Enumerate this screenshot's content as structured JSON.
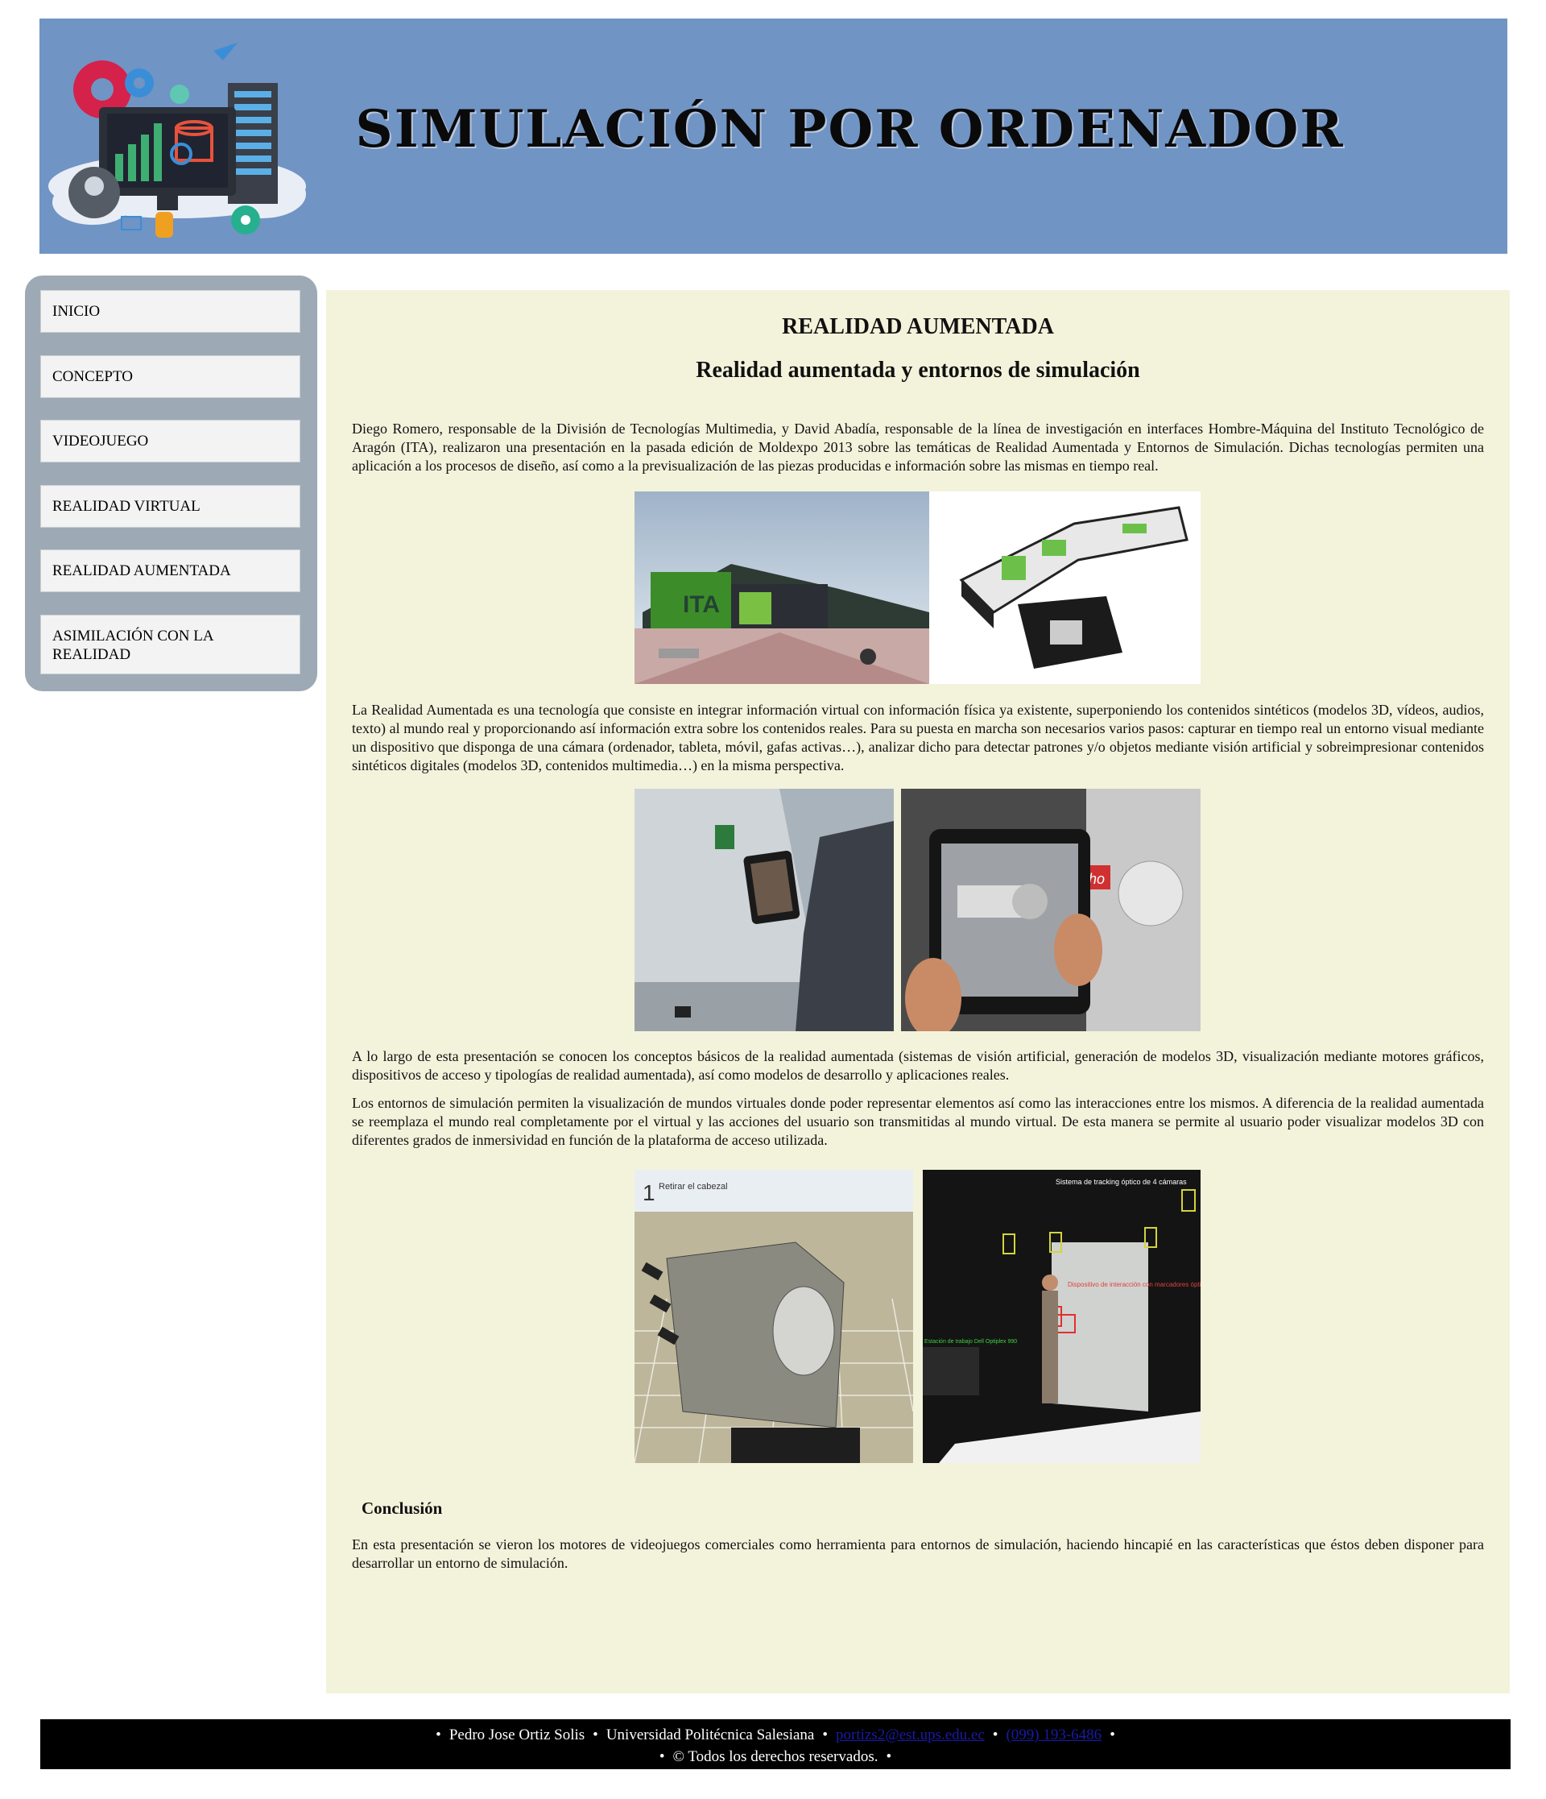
{
  "header": {
    "title": "SIMULACIÓN POR ORDENADOR",
    "logo_icon": "computer-server-illustration"
  },
  "sidebar": {
    "items": [
      {
        "label": "INICIO"
      },
      {
        "label": "CONCEPTO"
      },
      {
        "label": "VIDEOJUEGO"
      },
      {
        "label": "REALIDAD VIRTUAL"
      },
      {
        "label": "REALIDAD AUMENTADA"
      },
      {
        "label": "ASIMILACIÓN CON LA REALIDAD"
      }
    ]
  },
  "main": {
    "title": "REALIDAD AUMENTADA",
    "subtitle": "Realidad aumentada y entornos de simulación",
    "paragraphs": [
      "Diego Romero, responsable de la División de Tecnologías Multimedia, y David Abadía, responsable de la línea de investigación en interfaces Hombre-Máquina del Instituto Tecnológico de Aragón (ITA), realizaron una presentación en la pasada edición de Moldexpo 2013 sobre las temáticas de Realidad Aumentada y Entornos de Simulación. Dichas tecnologías permiten una aplicación a los procesos de diseño, así como a la previsualización de las piezas producidas e información sobre las mismas en tiempo real.",
      "La Realidad Aumentada es una tecnología que consiste en integrar información virtual con información física ya existente, superponiendo los contenidos sintéticos (modelos 3D, vídeos, audios, texto) al mundo real y proporcionando así información extra sobre los contenidos reales. Para su puesta en marcha son necesarios varios pasos: capturar en tiempo real un entorno visual mediante un dispositivo que disponga de una cámara (ordenador, tableta, móvil, gafas activas…), analizar dicho para detectar patrones y/o objetos mediante visión artificial y sobreimpresionar contenidos sintéticos digitales (modelos 3D, contenidos multimedia…) en la misma perspectiva.",
      "A lo largo de esta presentación se conocen los conceptos básicos de la realidad aumentada (sistemas de visión artificial, generación de modelos 3D, visualización mediante motores gráficos, dispositivos de acceso y tipologías de realidad aumentada), así como modelos de desarrollo y aplicaciones reales.",
      "Los entornos de simulación permiten la visualización de mundos virtuales donde poder representar elementos así como las interacciones entre los mismos. A diferencia de la realidad aumentada se reemplaza el mundo real completamente por el virtual y las acciones del usuario son transmitidas al mundo virtual. De esta manera se permite al usuario poder visualizar modelos 3D con diferentes grados de inmersividad en función de la plataforma de acceso utilizada."
    ],
    "conclusion_heading": "Conclusión",
    "conclusion_text": "En esta presentación se vieron los motores de videojuegos comerciales como herramienta para entornos de simulación, haciendo hincapié en las características que éstos deben disponer para desarrollar un entorno de simulación.",
    "image_texts": {
      "building_sign": "ITA",
      "sim_header": "Retirar el cabezal",
      "sim_step": "1",
      "tablet_brand": "ho",
      "tracking_label": "Sistema de tracking óptico de 4 cámaras",
      "device_label": "Dispositivo de interacción con marcadores ópticos",
      "station_label": "Estación de trabajo Dell Optiplex 990"
    }
  },
  "footer": {
    "name": "Pedro Jose Ortiz Solis",
    "university": "Universidad Politécnica Salesiana",
    "email": "portizs2@est.ups.edu.ec",
    "phone": "(099) 193-6486",
    "copyright": "© Todos los derechos reservados."
  },
  "colors": {
    "header_bg": "#7094c4",
    "sidebar_bg": "#9daab5",
    "main_bg": "#f3f3dc",
    "footer_bg": "#000000",
    "link": "#1a1aa6"
  }
}
